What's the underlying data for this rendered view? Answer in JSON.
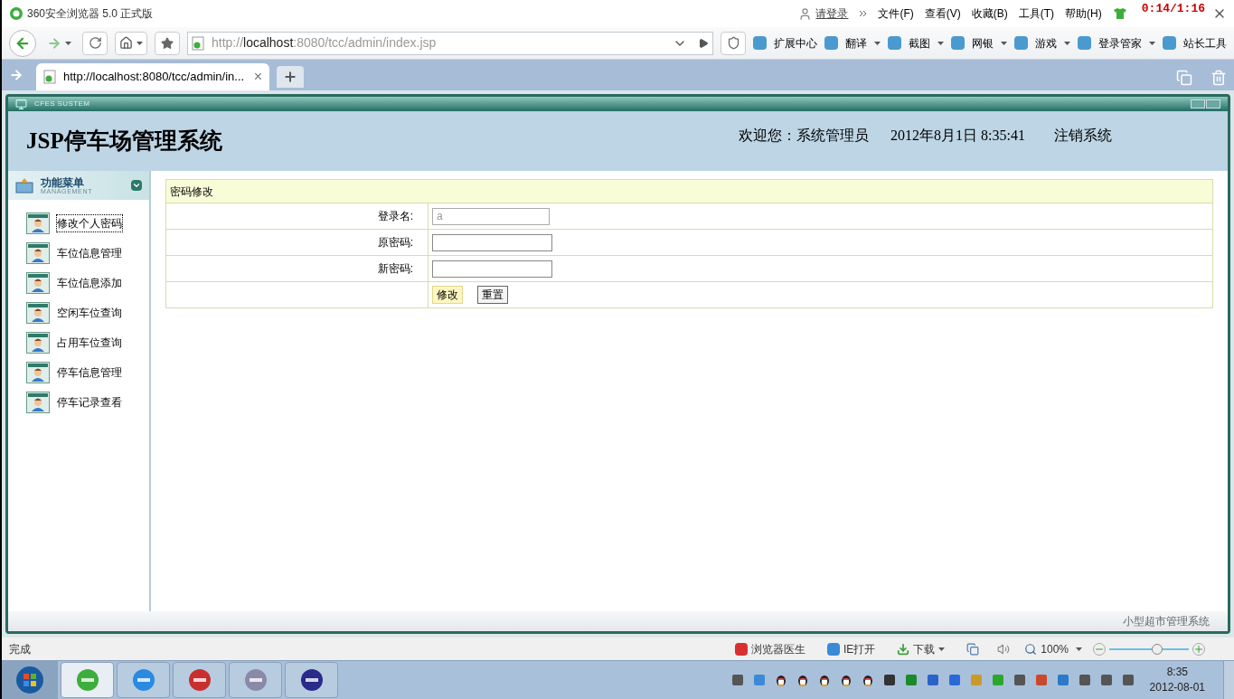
{
  "browser": {
    "title": "360安全浏览器 5.0 正式版",
    "login": "请登录",
    "menu": [
      "文件(F)",
      "查看(V)",
      "收藏(B)",
      "工具(T)",
      "帮助(H)"
    ],
    "timer": "0:14/1:16",
    "address": {
      "scheme": "http://",
      "host": "localhost",
      "path": ":8080/tcc/admin/index.jsp"
    },
    "toolbar": [
      {
        "label": "扩展中心",
        "dropdown": false
      },
      {
        "label": "翻译",
        "dropdown": true
      },
      {
        "label": "截图",
        "dropdown": true
      },
      {
        "label": "网银",
        "dropdown": true
      },
      {
        "label": "游戏",
        "dropdown": true
      },
      {
        "label": "登录管家",
        "dropdown": true
      },
      {
        "label": "站长工具",
        "dropdown": false
      }
    ],
    "tab": {
      "title": "http://localhost:8080/tcc/admin/in...",
      "close": "×"
    }
  },
  "page": {
    "banner": "CFES SUSTEM",
    "title": "JSP停车场管理系统",
    "welcome": "欢迎您：",
    "user": "系统管理员",
    "datetime": "2012年8月1日  8:35:41",
    "logout": "注销系统",
    "footer": "小型超市管理系统"
  },
  "sidebar": {
    "title": "功能菜单",
    "subtitle": "MANAGEMENT",
    "items": [
      {
        "label": "修改个人密码",
        "selected": true
      },
      {
        "label": "车位信息管理",
        "selected": false
      },
      {
        "label": "车位信息添加",
        "selected": false
      },
      {
        "label": "空闲车位查询",
        "selected": false
      },
      {
        "label": "占用车位查询",
        "selected": false
      },
      {
        "label": "停车信息管理",
        "selected": false
      },
      {
        "label": "停车记录查看",
        "selected": false
      }
    ]
  },
  "form": {
    "title": "密码修改",
    "fields": [
      {
        "label": "登录名:",
        "value": "a",
        "disabled": true
      },
      {
        "label": "原密码:",
        "disabled": false
      },
      {
        "label": "新密码:",
        "disabled": false
      }
    ],
    "buttons": [
      {
        "label": "修改",
        "hovered": true
      },
      {
        "label": "重置",
        "hovered": false
      }
    ]
  },
  "status": {
    "text": "完成",
    "items": [
      "浏览器医生",
      "IE打开",
      "下载"
    ],
    "zoom": "100%",
    "zoom_slider": {
      "level": 0.6
    }
  },
  "taskbar": {
    "time": "8:35",
    "date": "2012-08-01"
  }
}
